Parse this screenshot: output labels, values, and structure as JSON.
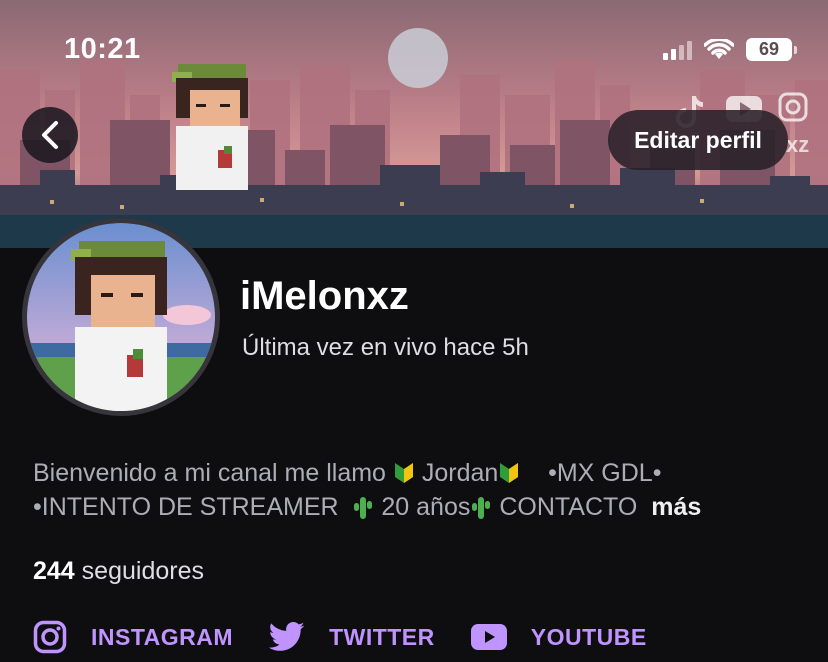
{
  "status_bar": {
    "time": "10:21",
    "battery": "69"
  },
  "header": {
    "edit_profile": "Editar perfil"
  },
  "profile": {
    "username": "iMelonxz",
    "last_live": "Última vez en vivo hace 5h",
    "bio": {
      "line1_a": "Bienvenido a mi canal me llamo ",
      "line1_b": "Jordan",
      "line1_c": "   •MX GDL•",
      "line2_a": "•INTENTO DE STREAMER  ",
      "line2_b": "20 años",
      "line2_c": "CONTACTO",
      "more": "más"
    },
    "followers_count": "244",
    "followers_label": "seguidores"
  },
  "socials": [
    {
      "label": "INSTAGRAM",
      "icon": "instagram-icon"
    },
    {
      "label": "TWITTER",
      "icon": "twitter-icon"
    },
    {
      "label": "YOUTUBE",
      "icon": "youtube-icon"
    }
  ],
  "banner_icons": [
    "tiktok-icon",
    "youtube-icon",
    "instagram-icon"
  ],
  "colors": {
    "accent": "#bf94ff",
    "background": "#0e0e10"
  }
}
